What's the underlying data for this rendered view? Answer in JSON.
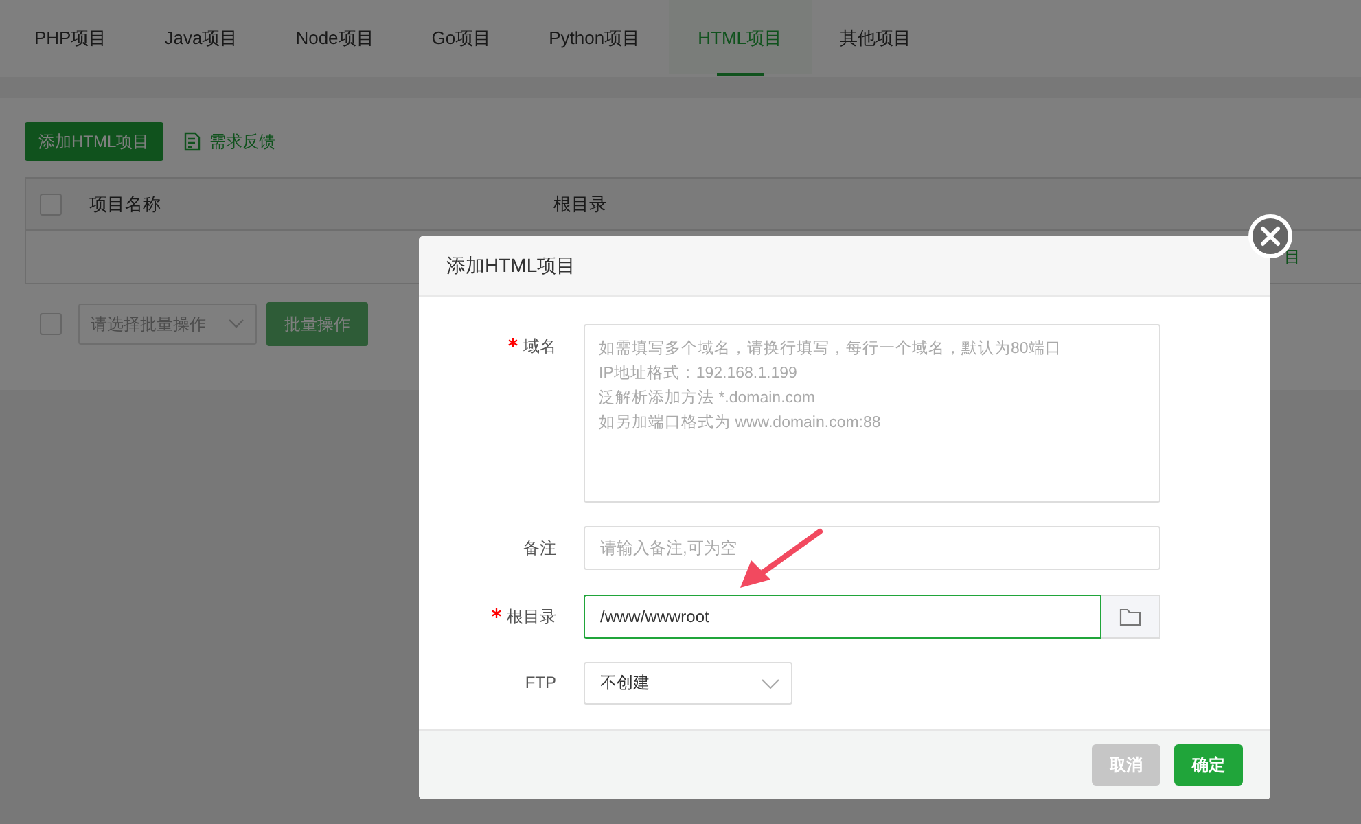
{
  "tabs": [
    {
      "label": "PHP项目",
      "selected": false
    },
    {
      "label": "Java项目",
      "selected": false
    },
    {
      "label": "Node项目",
      "selected": false
    },
    {
      "label": "Go项目",
      "selected": false
    },
    {
      "label": "Python项目",
      "selected": false
    },
    {
      "label": "HTML项目",
      "selected": true
    },
    {
      "label": "其他项目",
      "selected": false
    }
  ],
  "toolbar": {
    "add_button": "添加HTML项目",
    "feedback_link": "需求反馈"
  },
  "table": {
    "header_checked": false,
    "columns": [
      "项目名称",
      "根目录"
    ],
    "row_fragment": "目"
  },
  "bulk": {
    "checked": false,
    "select_placeholder": "请选择批量操作",
    "button": "批量操作"
  },
  "modal": {
    "title": "添加HTML项目",
    "fields": [
      {
        "kind": "textarea",
        "label": "域名",
        "required": true,
        "placeholder": "如需填写多个域名，请换行填写，每行一个域名，默认为80端口\nIP地址格式：192.168.1.199\n泛解析添加方法 *.domain.com\n如另加端口格式为 www.domain.com:88"
      },
      {
        "kind": "input",
        "label": "备注",
        "required": false,
        "placeholder": "请输入备注,可为空"
      },
      {
        "kind": "path",
        "label": "根目录",
        "required": true,
        "value": "/www/wwwroot",
        "focused": true
      },
      {
        "kind": "select",
        "label": "FTP",
        "required": false,
        "value": "不创建"
      }
    ],
    "buttons": [
      {
        "label": "取消",
        "kind": "cancel"
      },
      {
        "label": "确定",
        "kind": "confirm"
      }
    ]
  }
}
